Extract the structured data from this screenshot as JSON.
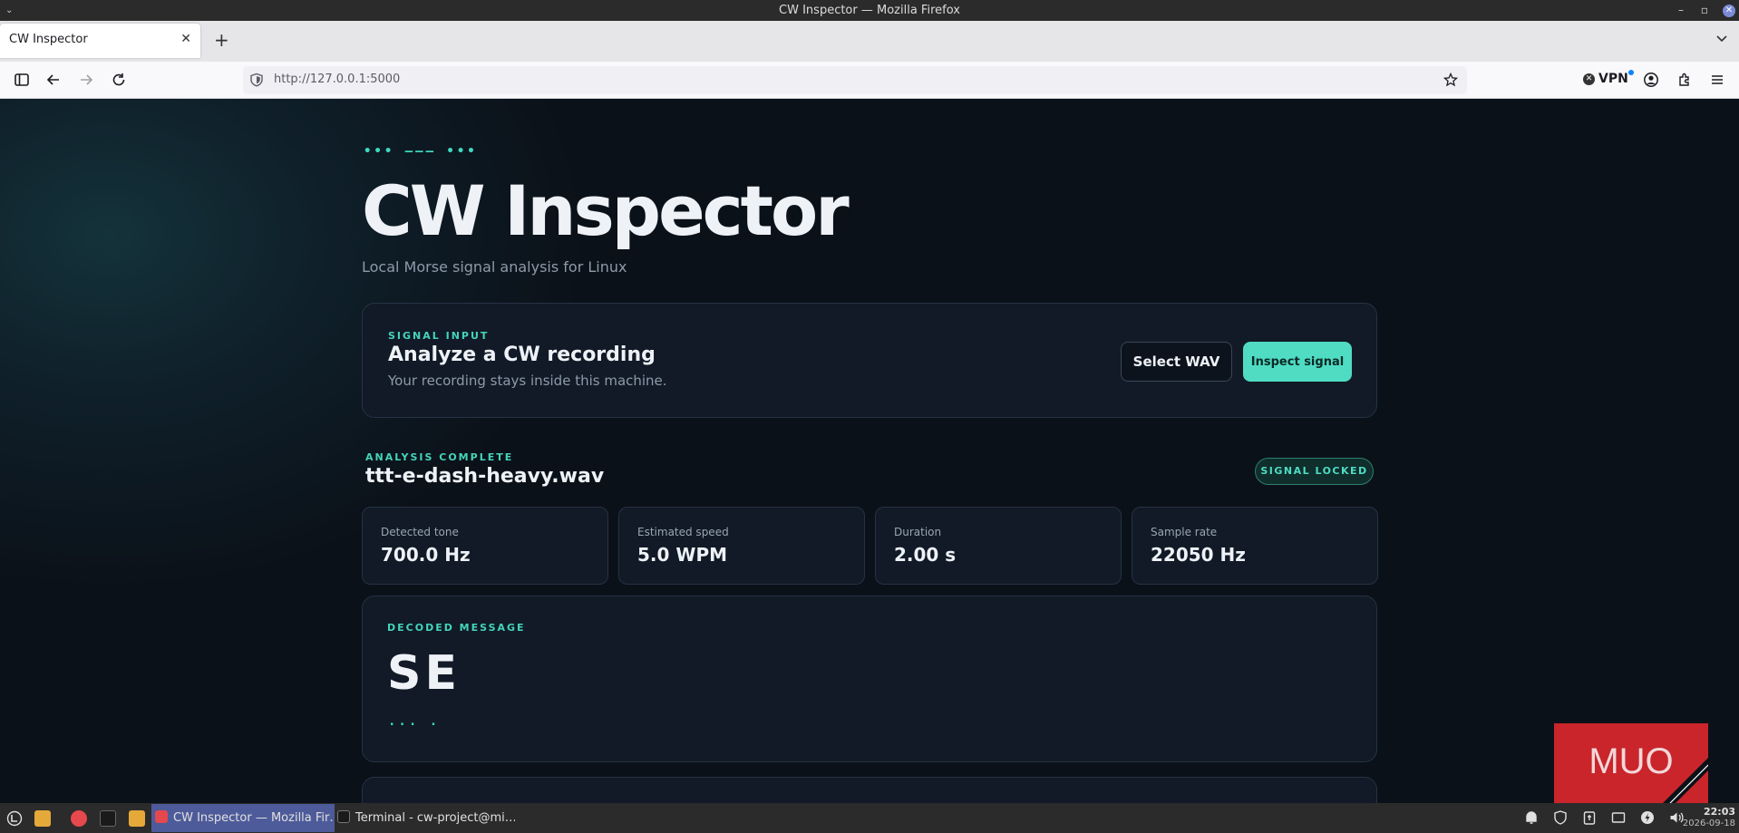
{
  "window": {
    "title": "CW Inspector — Mozilla Firefox",
    "menu_glyph": "⌄"
  },
  "browser": {
    "tab_title": "CW Inspector",
    "url": "http://127.0.0.1:5000",
    "vpn_label": "VPN"
  },
  "page": {
    "morse_deco": "••• ––– •••",
    "title": "CW Inspector",
    "subtitle": "Local Morse signal analysis for Linux",
    "input_card": {
      "eyebrow": "SIGNAL INPUT",
      "title": "Analyze a CW recording",
      "subtitle": "Your recording stays inside this machine.",
      "select_button": "Select WAV",
      "inspect_button": "Inspect signal"
    },
    "result": {
      "eyebrow": "ANALYSIS COMPLETE",
      "filename": "ttt-e-dash-heavy.wav",
      "badge": "SIGNAL LOCKED"
    },
    "stats": [
      {
        "label": "Detected tone",
        "value": "700.0 Hz"
      },
      {
        "label": "Estimated speed",
        "value": "5.0 WPM"
      },
      {
        "label": "Duration",
        "value": "2.00 s"
      },
      {
        "label": "Sample rate",
        "value": "22050 Hz"
      }
    ],
    "decoded": {
      "eyebrow": "DECODED MESSAGE",
      "text": "SE",
      "morse": "... ."
    },
    "watermark": "MUO"
  },
  "taskbar": {
    "tasks": [
      {
        "label": "CW Inspector — Mozilla Fir…"
      },
      {
        "label": "Terminal - cw-project@mi…"
      }
    ],
    "time": "22:03",
    "date": "2026-09-18"
  },
  "colors": {
    "accent": "#4fdcc3",
    "page_bg": "#0b1119",
    "card_bg": "#111a26"
  }
}
